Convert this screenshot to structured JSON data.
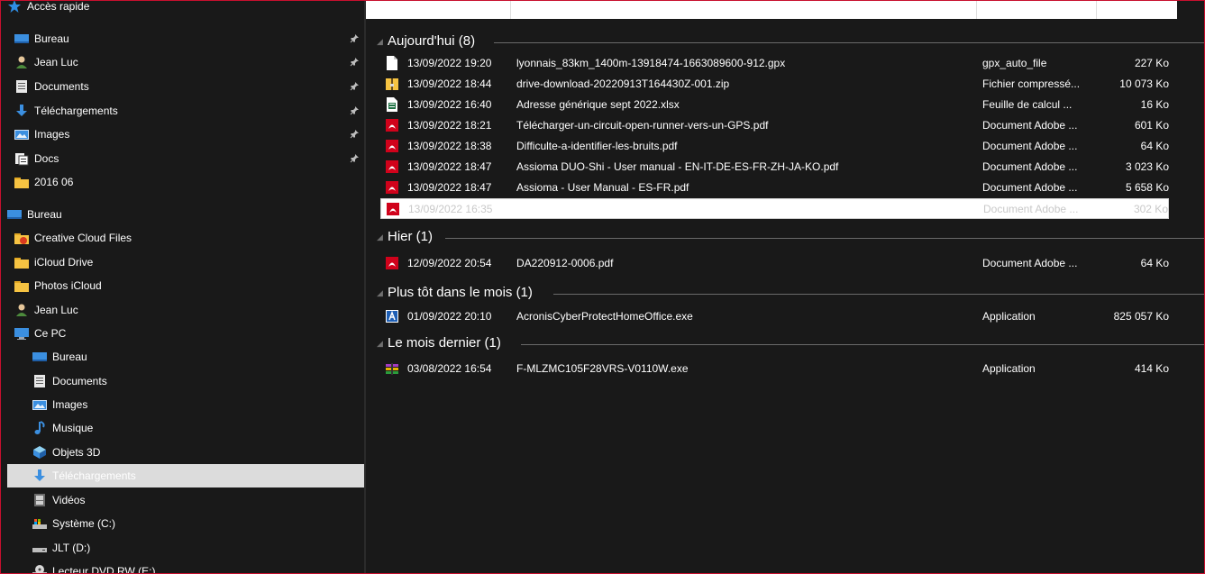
{
  "sidebar": {
    "quick_access": "Accès rapide",
    "quick_items": [
      {
        "label": "Bureau",
        "icon": "desktop-icon"
      },
      {
        "label": "Jean Luc",
        "icon": "user-icon"
      },
      {
        "label": "Documents",
        "icon": "documents-icon"
      },
      {
        "label": "Téléchargements",
        "icon": "download-icon"
      },
      {
        "label": "Images",
        "icon": "images-icon"
      },
      {
        "label": "Docs",
        "icon": "docs-icon"
      },
      {
        "label": "2016 06",
        "icon": "folder-icon"
      }
    ],
    "tree_items": [
      {
        "label": "Bureau",
        "icon": "desktop-icon"
      },
      {
        "label": "Creative Cloud Files",
        "icon": "creative-cloud-folder-icon"
      },
      {
        "label": "iCloud Drive",
        "icon": "folder-icon"
      },
      {
        "label": "Photos iCloud",
        "icon": "folder-icon"
      },
      {
        "label": "Jean Luc",
        "icon": "user-icon"
      },
      {
        "label": "Ce PC",
        "icon": "computer-icon"
      },
      {
        "label": "Bureau",
        "icon": "desktop-icon"
      },
      {
        "label": "Documents",
        "icon": "documents-icon"
      },
      {
        "label": "Images",
        "icon": "images-icon"
      },
      {
        "label": "Musique",
        "icon": "music-icon"
      },
      {
        "label": "Objets 3D",
        "icon": "3d-objects-icon"
      },
      {
        "label": "Téléchargements",
        "icon": "download-icon"
      },
      {
        "label": "Vidéos",
        "icon": "videos-icon"
      },
      {
        "label": "Système (C:)",
        "icon": "system-drive-icon"
      },
      {
        "label": "JLT (D:)",
        "icon": "drive-icon"
      },
      {
        "label": "Lecteur DVD RW (E:)",
        "icon": "dvd-drive-icon"
      }
    ]
  },
  "groups": [
    {
      "title": "Aujourd'hui (8)",
      "files": [
        {
          "icon": "file-icon",
          "date": "13/09/2022 19:20",
          "name": "lyonnais_83km_1400m-13918474-1663089600-912.gpx",
          "type": "gpx_auto_file",
          "size": "227 Ko"
        },
        {
          "icon": "zip-icon",
          "date": "13/09/2022 18:44",
          "name": "drive-download-20220913T164430Z-001.zip",
          "type": "Fichier compressé...",
          "size": "10 073 Ko"
        },
        {
          "icon": "excel-icon",
          "date": "13/09/2022 16:40",
          "name": "Adresse générique sept 2022.xlsx",
          "type": "Feuille de calcul ...",
          "size": "16 Ko"
        },
        {
          "icon": "pdf-icon",
          "date": "13/09/2022 18:21",
          "name": "Télécharger-un-circuit-open-runner-vers-un-GPS.pdf",
          "type": "Document Adobe ...",
          "size": "601 Ko"
        },
        {
          "icon": "pdf-icon",
          "date": "13/09/2022 18:38",
          "name": "Difficulte-a-identifier-les-bruits.pdf",
          "type": "Document Adobe ...",
          "size": "64 Ko"
        },
        {
          "icon": "pdf-icon",
          "date": "13/09/2022 18:47",
          "name": "Assioma DUO-Shi - User manual - EN-IT-DE-ES-FR-ZH-JA-KO.pdf",
          "type": "Document Adobe ...",
          "size": "3 023 Ko"
        },
        {
          "icon": "pdf-icon",
          "date": "13/09/2022 18:47",
          "name": "Assioma - User Manual - ES-FR.pdf",
          "type": "Document Adobe ...",
          "size": "5 658 Ko"
        },
        {
          "icon": "pdf-icon",
          "date": "13/09/2022 16:35",
          "name": "",
          "type": "Document Adobe ...",
          "size": "302 Ko"
        }
      ]
    },
    {
      "title": "Hier (1)",
      "files": [
        {
          "icon": "pdf-icon",
          "date": "12/09/2022 20:54",
          "name": "DA220912-0006.pdf",
          "type": "Document Adobe ...",
          "size": "64 Ko"
        }
      ]
    },
    {
      "title": "Plus tôt dans le mois (1)",
      "files": [
        {
          "icon": "acronis-app-icon",
          "date": "01/09/2022 20:10",
          "name": "AcronisCyberProtectHomeOffice.exe",
          "type": "Application",
          "size": "825 057 Ko"
        }
      ]
    },
    {
      "title": "Le mois dernier (1)",
      "files": [
        {
          "icon": "installer-app-icon",
          "date": "03/08/2022 16:54",
          "name": "F-MLZMC105F28VRS-V0110W.exe",
          "type": "Application",
          "size": "414 Ko"
        }
      ]
    }
  ],
  "colors": {
    "frame": "#c8102e",
    "selection": "#dcdcdc",
    "folder": "#f6c342",
    "pdf": "#d0021b",
    "excel": "#1f7244",
    "accent_blue": "#1e7ae6"
  }
}
